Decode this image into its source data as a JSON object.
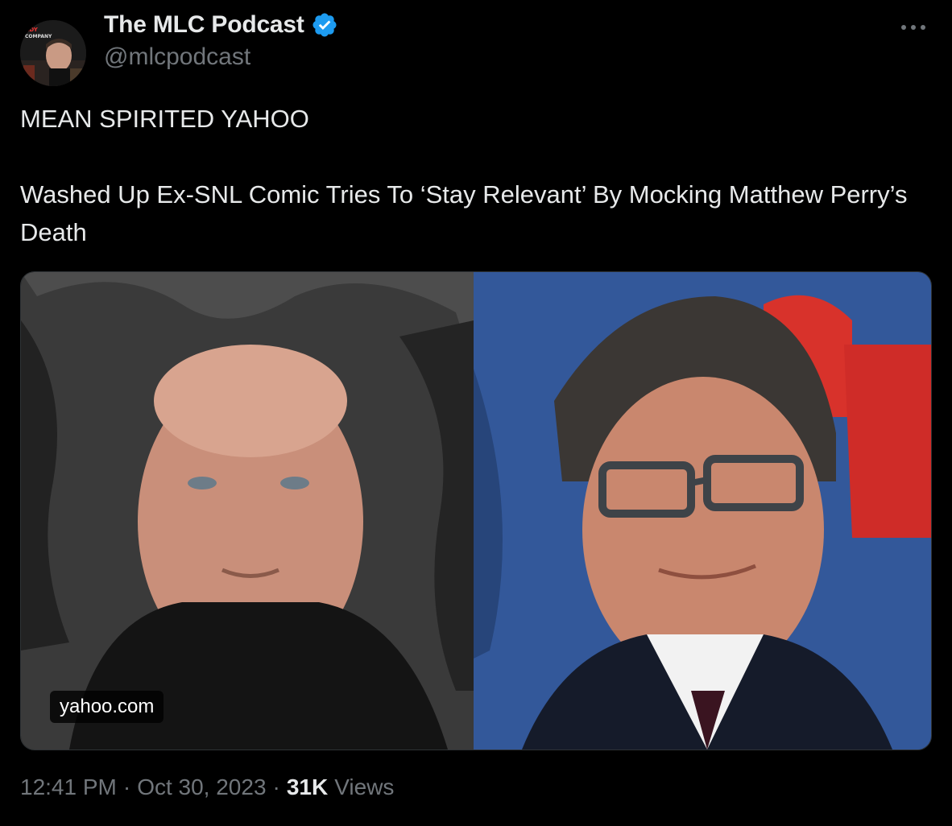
{
  "author": {
    "name": "The MLC Podcast",
    "handle": "@mlcpodcast",
    "verified": true,
    "avatar_icon": "podcast-host-avatar"
  },
  "menu": {
    "more_icon": "more-horizontal-icon"
  },
  "tweet": {
    "headline": "MEAN SPIRITED YAHOO",
    "body": "Washed Up Ex-SNL Comic Tries To ‘Stay Relevant’ By Mocking Matthew Perry’s Death"
  },
  "media": {
    "link_domain": "yahoo.com",
    "left_photo": "man-portrait-leather-chair",
    "right_photo": "man-portrait-glasses-blue-backdrop"
  },
  "meta": {
    "time": "12:41 PM",
    "separator": "·",
    "date": "Oct 30, 2023",
    "views_count": "31K",
    "views_label": "Views"
  },
  "colors": {
    "background": "#000000",
    "text": "#e7e9ea",
    "secondary": "#71767b",
    "verified": "#1d9bf0",
    "border": "#2f3336"
  }
}
